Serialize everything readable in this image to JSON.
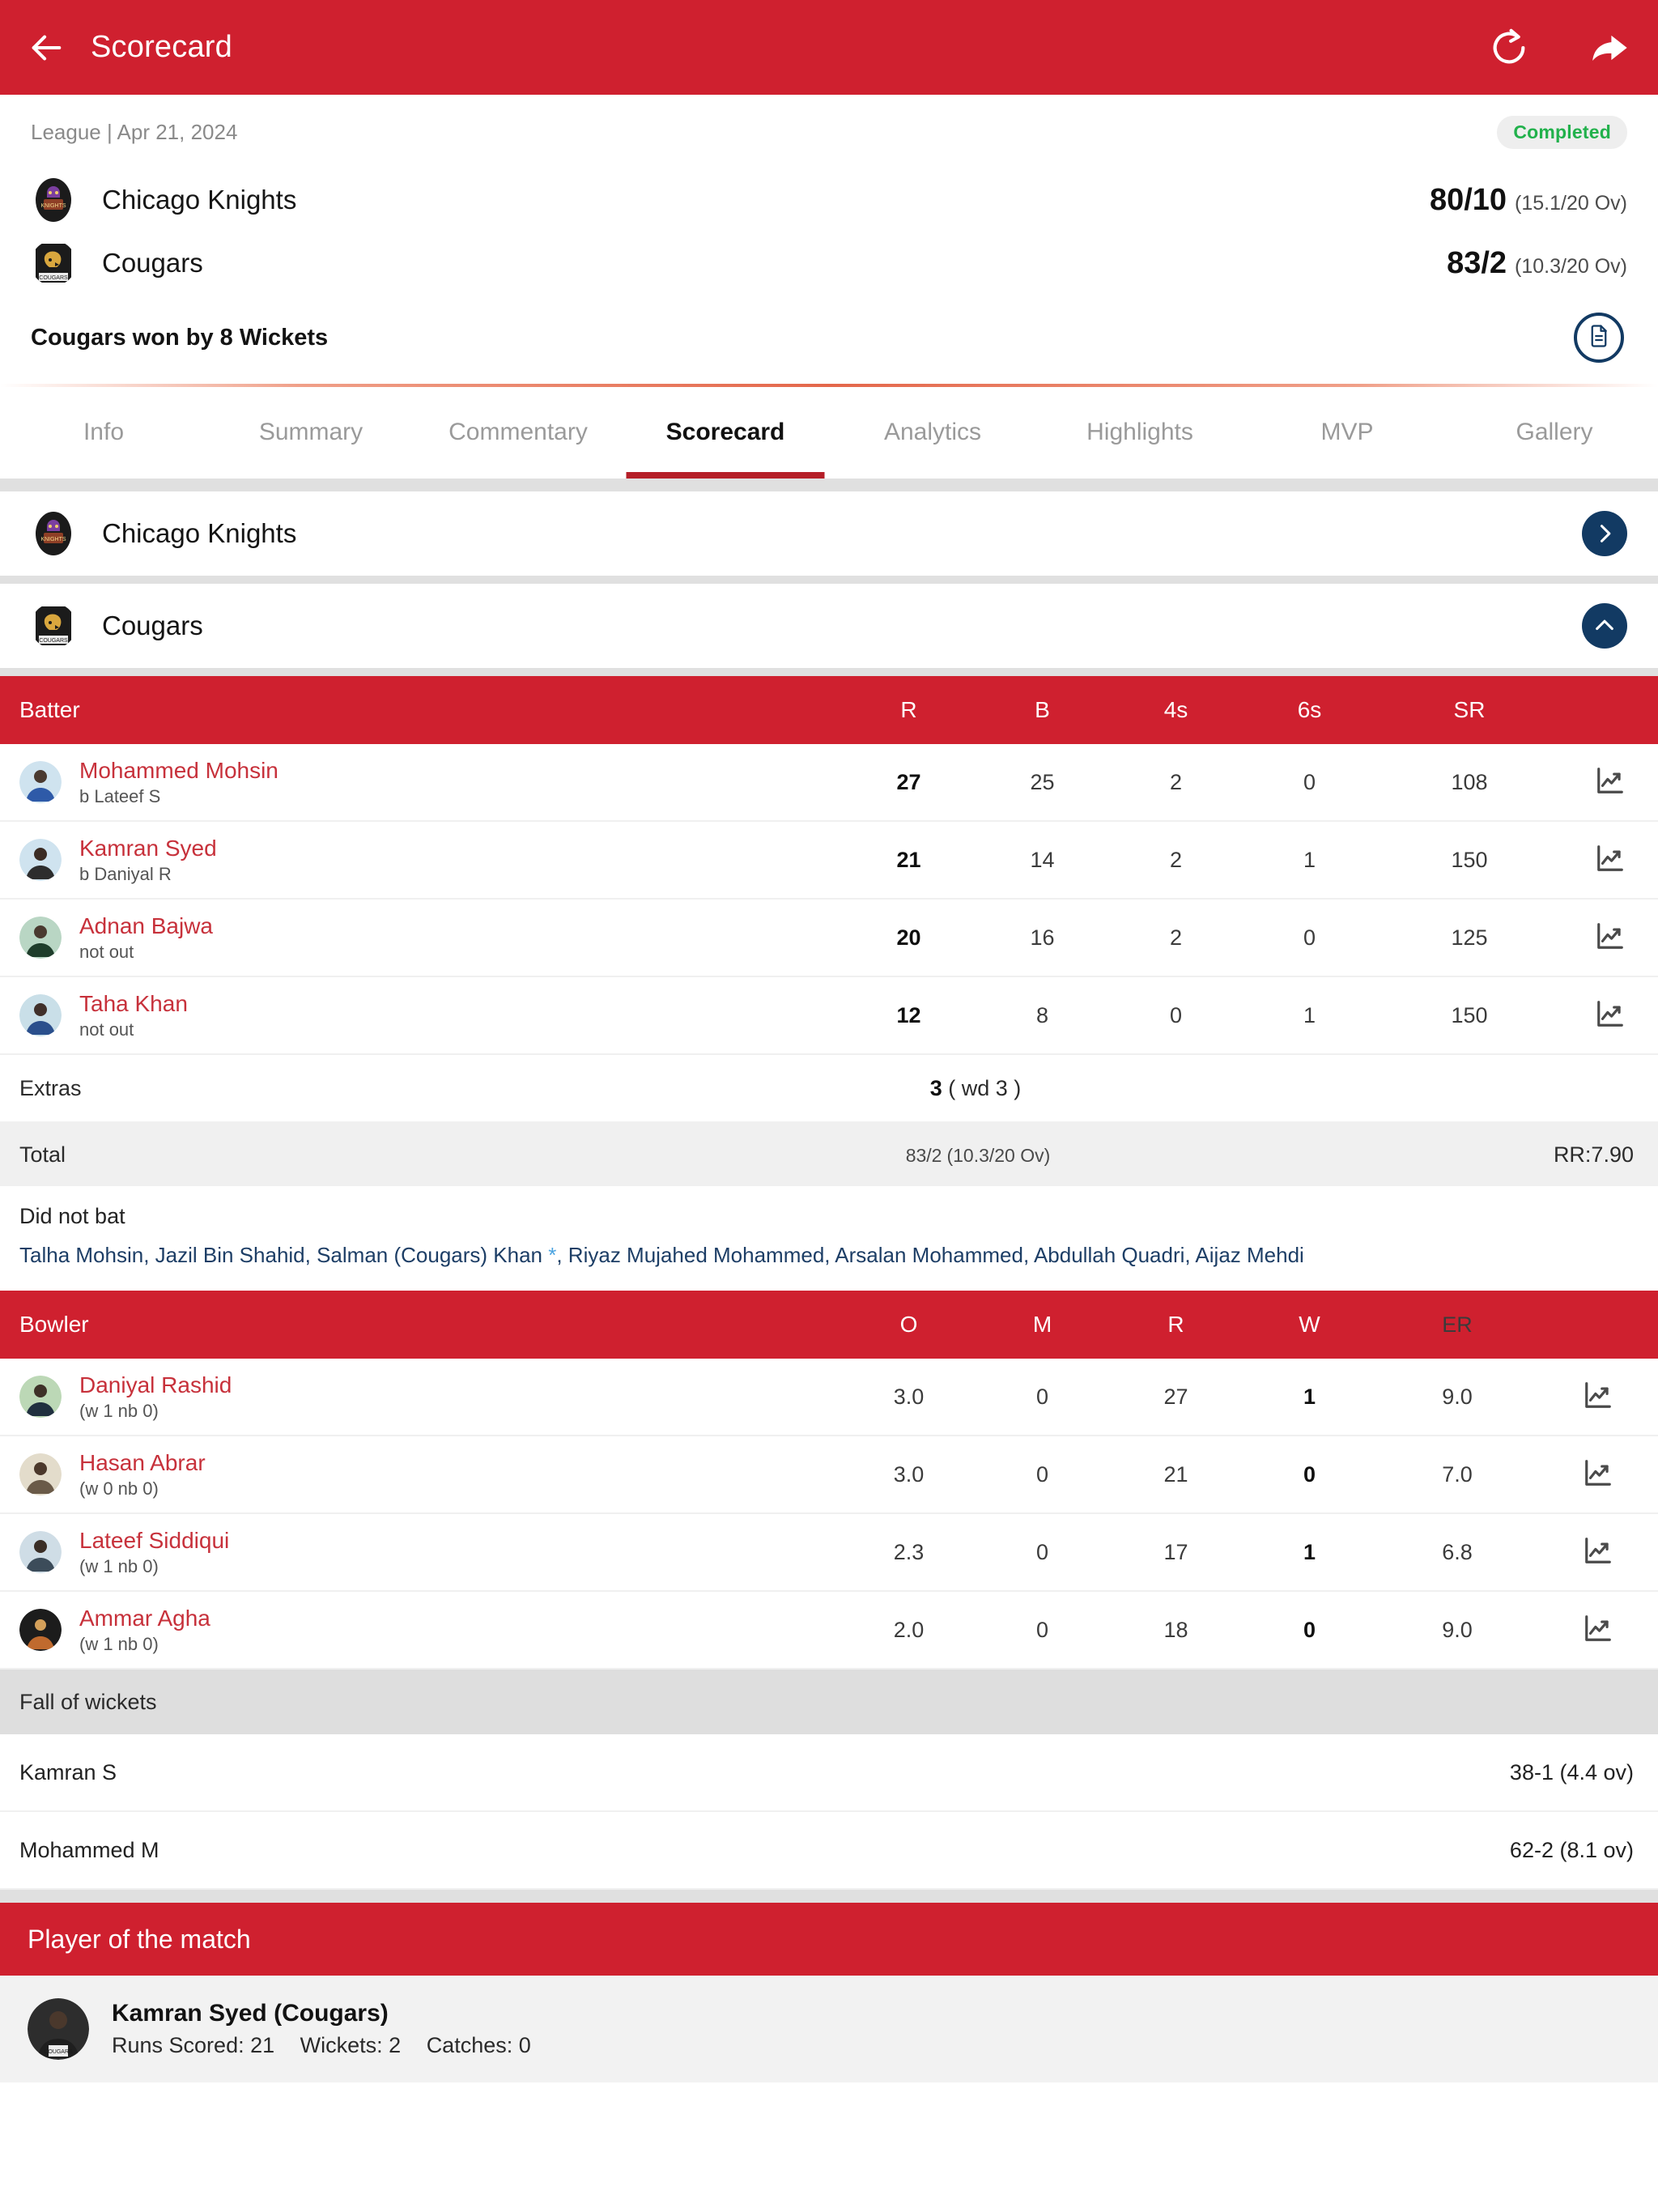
{
  "appbar": {
    "title": "Scorecard",
    "back_icon": "back-arrow-icon",
    "refresh_icon": "refresh-icon",
    "share_icon": "share-icon"
  },
  "match": {
    "meta": "League | Apr 21, 2024",
    "status_badge": "Completed",
    "teams": [
      {
        "name": "Chicago Knights",
        "score": "80/10",
        "overs": "(15.1/20 Ov)"
      },
      {
        "name": "Cougars",
        "score": "83/2",
        "overs": "(10.3/20 Ov)"
      }
    ],
    "result": "Cougars won by 8 Wickets",
    "report_icon": "document-report-icon"
  },
  "tabs": [
    {
      "label": "Info",
      "active": false
    },
    {
      "label": "Summary",
      "active": false
    },
    {
      "label": "Commentary",
      "active": false
    },
    {
      "label": "Scorecard",
      "active": true
    },
    {
      "label": "Analytics",
      "active": false
    },
    {
      "label": "Highlights",
      "active": false
    },
    {
      "label": "MVP",
      "active": false
    },
    {
      "label": "Gallery",
      "active": false
    }
  ],
  "innings": [
    {
      "team": "Chicago Knights",
      "expanded": false,
      "chevron": "chevron-right-icon"
    },
    {
      "team": "Cougars",
      "expanded": true,
      "chevron": "chevron-up-icon"
    }
  ],
  "batting": {
    "headers": {
      "name": "Batter",
      "r": "R",
      "b": "B",
      "fours": "4s",
      "sixes": "6s",
      "sr": "SR"
    },
    "rows": [
      {
        "name": "Mohammed Mohsin",
        "dismissal": "b Lateef S",
        "r": "27",
        "b": "25",
        "fours": "2",
        "sixes": "0",
        "sr": "108"
      },
      {
        "name": "Kamran Syed",
        "dismissal": "b Daniyal R",
        "r": "21",
        "b": "14",
        "fours": "2",
        "sixes": "1",
        "sr": "150"
      },
      {
        "name": "Adnan Bajwa",
        "dismissal": "not out",
        "r": "20",
        "b": "16",
        "fours": "2",
        "sixes": "0",
        "sr": "125"
      },
      {
        "name": "Taha Khan",
        "dismissal": "not out",
        "r": "12",
        "b": "8",
        "fours": "0",
        "sixes": "1",
        "sr": "150"
      }
    ],
    "extras": {
      "label": "Extras",
      "value": "3",
      "detail": "( wd 3 )"
    },
    "total": {
      "label": "Total",
      "score": "83/2",
      "overs": "(10.3/20 Ov)",
      "run_rate": "RR:7.90"
    },
    "did_not_bat": {
      "label": "Did not bat",
      "names": "Talha Mohsin, Jazil Bin Shahid, Salman (Cougars) Khan *, Riyaz Mujahed Mohammed, Arsalan Mohammed, Abdullah Quadri, Aijaz Mehdi"
    }
  },
  "bowling": {
    "headers": {
      "name": "Bowler",
      "o": "O",
      "m": "M",
      "r": "R",
      "w": "W",
      "er": "ER"
    },
    "rows": [
      {
        "name": "Daniyal Rashid",
        "sub": "(w 1 nb 0)",
        "o": "3.0",
        "m": "0",
        "r": "27",
        "w": "1",
        "er": "9.0"
      },
      {
        "name": "Hasan Abrar",
        "sub": "(w 0 nb 0)",
        "o": "3.0",
        "m": "0",
        "r": "21",
        "w": "0",
        "er": "7.0"
      },
      {
        "name": "Lateef Siddiqui",
        "sub": "(w 1 nb 0)",
        "o": "2.3",
        "m": "0",
        "r": "17",
        "w": "1",
        "er": "6.8"
      },
      {
        "name": "Ammar Agha",
        "sub": "(w 1 nb 0)",
        "o": "2.0",
        "m": "0",
        "r": "18",
        "w": "0",
        "er": "9.0"
      }
    ]
  },
  "fall_of_wickets": {
    "title": "Fall of wickets",
    "rows": [
      {
        "batter": "Kamran S",
        "detail": "38-1 (4.4 ov)"
      },
      {
        "batter": "Mohammed M",
        "detail": "62-2 (8.1 ov)"
      }
    ]
  },
  "player_of_the_match": {
    "title": "Player of the match",
    "name": "Kamran Syed (Cougars)",
    "runs": "Runs Scored: 21",
    "wickets": "Wickets: 2",
    "catches": "Catches: 0"
  },
  "colors": {
    "brand_red": "#cf202f",
    "accent_dark_blue": "#123a63",
    "status_green": "#22b14c",
    "player_link": "#c7313b",
    "link_blue": "#1d3e66"
  }
}
